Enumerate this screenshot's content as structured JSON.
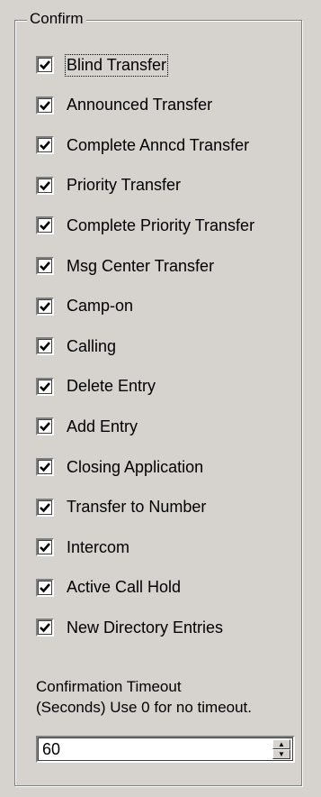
{
  "group": {
    "title": "Confirm"
  },
  "checkboxes": [
    {
      "label": "Blind Transfer",
      "checked": true
    },
    {
      "label": "Announced Transfer",
      "checked": true
    },
    {
      "label": "Complete Anncd Transfer",
      "checked": true
    },
    {
      "label": "Priority Transfer",
      "checked": true
    },
    {
      "label": "Complete Priority Transfer",
      "checked": true
    },
    {
      "label": "Msg Center Transfer",
      "checked": true
    },
    {
      "label": "Camp-on",
      "checked": true
    },
    {
      "label": "Calling",
      "checked": true
    },
    {
      "label": "Delete Entry",
      "checked": true
    },
    {
      "label": "Add Entry",
      "checked": true
    },
    {
      "label": "Closing Application",
      "checked": true
    },
    {
      "label": "Transfer to Number",
      "checked": true
    },
    {
      "label": "Intercom",
      "checked": true
    },
    {
      "label": "Active Call Hold",
      "checked": true
    },
    {
      "label": "New Directory Entries",
      "checked": true
    }
  ],
  "timeout": {
    "label_line1": "Confirmation Timeout",
    "label_line2": "(Seconds) Use 0 for no timeout.",
    "value": "60"
  },
  "icons": {
    "check": "checkmark-icon",
    "up": "spin-up-arrow-icon",
    "down": "spin-down-arrow-icon"
  }
}
